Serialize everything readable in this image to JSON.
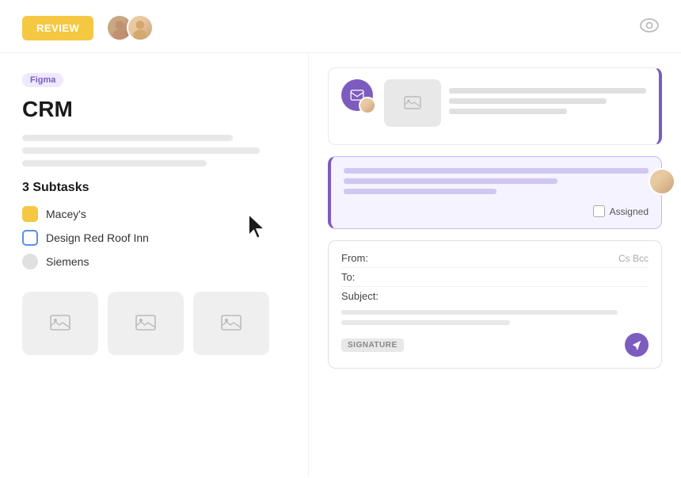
{
  "header": {
    "review_label": "REVIEW",
    "eye_icon": "eye"
  },
  "left": {
    "badge": "Figma",
    "title": "CRM",
    "subtasks_heading": "3 Subtasks",
    "subtasks": [
      {
        "label": "Macey's",
        "type": "yellow"
      },
      {
        "label": "Design Red Roof Inn",
        "type": "blue"
      },
      {
        "label": "Siemens",
        "type": "gray"
      }
    ]
  },
  "right": {
    "card1": {
      "lines": [
        "100",
        "80",
        "60"
      ]
    },
    "card2": {
      "lines": [
        "100",
        "70",
        "50"
      ],
      "assigned_label": "Assigned"
    },
    "compose": {
      "from_label": "From:",
      "to_label": "To:",
      "subject_label": "Subject:",
      "cc_label": "Cs Bcc",
      "signature_label": "SIGNATURE"
    }
  }
}
